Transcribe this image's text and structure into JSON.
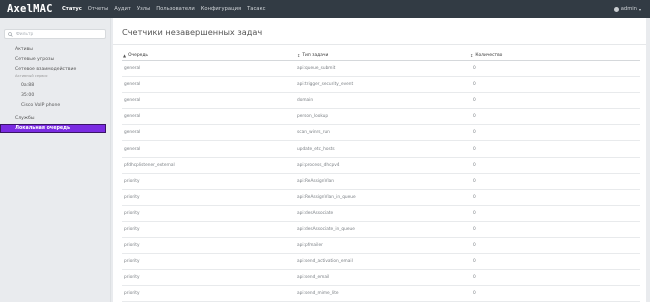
{
  "app": {
    "logo": "AxelMAC"
  },
  "nav": {
    "items": [
      {
        "label": "Статус",
        "active": true
      },
      {
        "label": "Отчеты",
        "active": false
      },
      {
        "label": "Аудит",
        "active": false
      },
      {
        "label": "Узлы",
        "active": false
      },
      {
        "label": "Пользователи",
        "active": false
      },
      {
        "label": "Конфигурация",
        "active": false
      },
      {
        "label": "Тасакс",
        "active": false
      }
    ],
    "user": "admin"
  },
  "sidebar": {
    "filter_placeholder": "Фильтр",
    "items": [
      {
        "label": "Активы"
      },
      {
        "label": "Сетевые угрозы"
      },
      {
        "label": "Сетевое взаимодействие"
      }
    ],
    "sub_caption": "Активный сервис",
    "children": [
      {
        "label": "0a:88"
      },
      {
        "label": "35:00"
      },
      {
        "label": "Cisco VoIP phone"
      }
    ],
    "services": "Службы",
    "active": "Локальная очередь"
  },
  "main": {
    "title": "Счетчики незавершенных задач",
    "columns": [
      "Очередь",
      "Тип задачи",
      "Количество"
    ],
    "rows": [
      {
        "queue": "general",
        "task": "api:queue_submit",
        "count": "0"
      },
      {
        "queue": "general",
        "task": "api:trigger_security_event",
        "count": "0"
      },
      {
        "queue": "general",
        "task": "domain",
        "count": "0"
      },
      {
        "queue": "general",
        "task": "person_lookup",
        "count": "0"
      },
      {
        "queue": "general",
        "task": "scan_winrs_run",
        "count": "0"
      },
      {
        "queue": "general",
        "task": "update_etc_hosts",
        "count": "0"
      },
      {
        "queue": "pfdhcplistener_external",
        "task": "api:process_dhcpv4",
        "count": "0"
      },
      {
        "queue": "priority",
        "task": "api:ReAssignVlan",
        "count": "0"
      },
      {
        "queue": "priority",
        "task": "api:ReAssignVlan_in_queue",
        "count": "0"
      },
      {
        "queue": "priority",
        "task": "api:desAssociate",
        "count": "0"
      },
      {
        "queue": "priority",
        "task": "api:desAssociate_in_queue",
        "count": "0"
      },
      {
        "queue": "priority",
        "task": "api:pfmailer",
        "count": "0"
      },
      {
        "queue": "priority",
        "task": "api:send_activation_email",
        "count": "0"
      },
      {
        "queue": "priority",
        "task": "api:send_email",
        "count": "0"
      },
      {
        "queue": "priority",
        "task": "api:send_mime_lite",
        "count": "0"
      }
    ]
  },
  "colors": {
    "navbar": "#323b44",
    "active_item": "#7a2be2",
    "background": "#e9ebee"
  }
}
